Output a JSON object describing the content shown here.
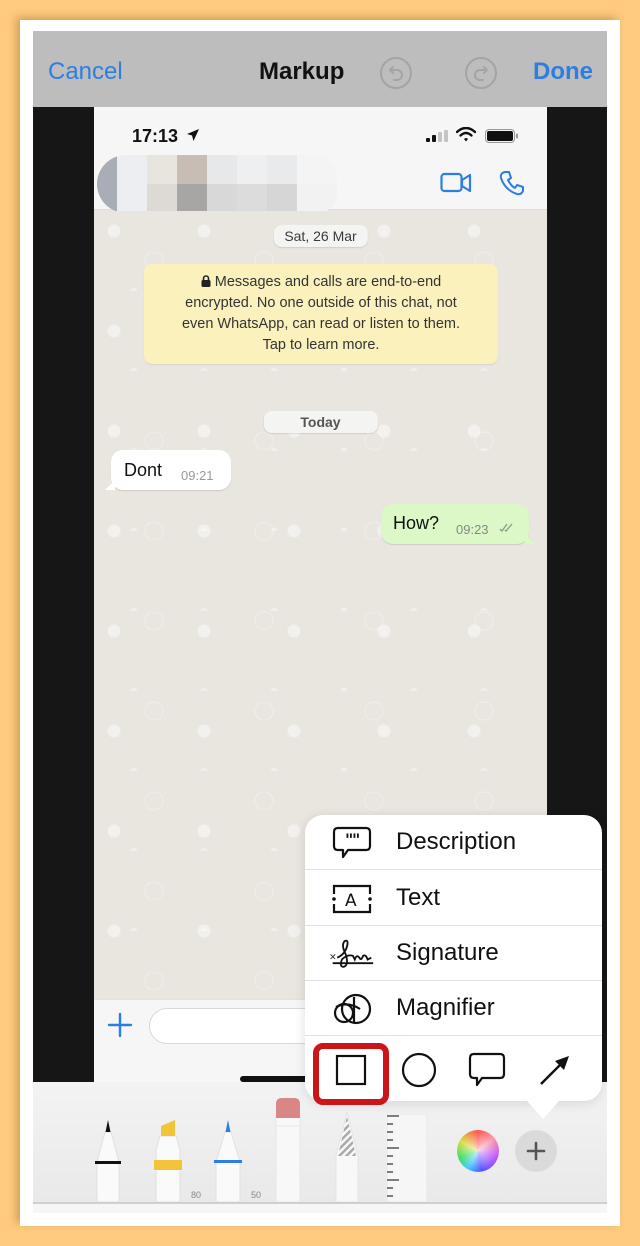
{
  "navbar": {
    "cancel_label": "Cancel",
    "title": "Markup",
    "undo_icon": "undo-icon",
    "redo_icon": "redo-icon",
    "done_label": "Done"
  },
  "phone": {
    "status_bar": {
      "time": "17:13",
      "icons": [
        "location-arrow-icon",
        "cellular-signal-icon",
        "wifi-icon",
        "battery-icon"
      ]
    },
    "chat_header": {
      "contact_name": "[redacted]",
      "actions": [
        "video-call-icon",
        "phone-call-icon"
      ]
    },
    "chat": {
      "date_divider": "Sat, 26 Mar",
      "encryption_notice": {
        "icon": "lock-icon",
        "lines": [
          "Messages and calls are end-to-end",
          "encrypted. No one outside of this chat, not",
          "even WhatsApp, can read or listen to them.",
          "Tap to learn more."
        ]
      },
      "today_divider": "Today",
      "messages": [
        {
          "direction": "incoming",
          "text": "Dont",
          "time": "09:21"
        },
        {
          "direction": "outgoing",
          "text": "How?",
          "time": "09:23",
          "status": "read-double-check"
        }
      ]
    },
    "input_bar": {
      "attach_icon": "plus-icon",
      "message_placeholder": ""
    }
  },
  "popover": {
    "items": [
      {
        "label": "Description",
        "icon": "quote-bubble-icon"
      },
      {
        "label": "Text",
        "icon": "text-box-icon"
      },
      {
        "label": "Signature",
        "icon": "signature-icon"
      },
      {
        "label": "Magnifier",
        "icon": "magnifier-icon"
      }
    ],
    "shapes": [
      {
        "name": "square",
        "icon": "square-shape-icon",
        "highlighted": true
      },
      {
        "name": "circle",
        "icon": "circle-shape-icon",
        "highlighted": false
      },
      {
        "name": "speech-bubble",
        "icon": "speech-bubble-shape-icon",
        "highlighted": false
      },
      {
        "name": "arrow",
        "icon": "arrow-shape-icon",
        "highlighted": false
      }
    ],
    "highlight_color": "#cc1518"
  },
  "toolbar": {
    "tools": [
      {
        "name": "pen",
        "color": "#111111",
        "label": ""
      },
      {
        "name": "highlighter",
        "color": "#f2c43a",
        "label": "80"
      },
      {
        "name": "pencil",
        "color": "#2c7fe0",
        "label": "50"
      },
      {
        "name": "eraser",
        "color": "#d98686",
        "label": ""
      },
      {
        "name": "lasso",
        "color": "#aaaaaa",
        "label": ""
      },
      {
        "name": "ruler",
        "color": "#eeeeee",
        "label": ""
      }
    ],
    "color_picker_icon": "color-wheel-icon",
    "add_icon": "plus-icon"
  },
  "colors": {
    "accent": "#2c7fe0",
    "frame_background": "#FFCB80",
    "outgoing_bubble": "#dcf8c6",
    "encryption_notice_bg": "#fbf1bd"
  }
}
